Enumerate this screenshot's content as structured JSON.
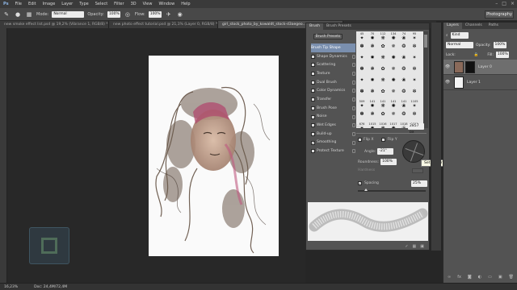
{
  "menu": {
    "items": [
      "File",
      "Edit",
      "Image",
      "Layer",
      "Type",
      "Select",
      "Filter",
      "3D",
      "View",
      "Window",
      "Help"
    ],
    "window_controls": [
      "–",
      "□",
      "×"
    ]
  },
  "options_bar": {
    "mode_label": "Mode:",
    "mode_value": "Normal",
    "opacity_label": "Opacity:",
    "opacity_value": "100%",
    "flow_label": "Flow:",
    "flow_value": "100%",
    "workspace": "Photography"
  },
  "tabs": [
    {
      "label": "new smoke effect list.psd @ 19,2% (Vibrance 1, RGB/8) *"
    },
    {
      "label": "new photo effect tutorial.psd @ 21,1% (Layer 0, RGB/8) *"
    },
    {
      "label": "girl_stock_photo_by_kowaldt_stock-d3aegeo..."
    }
  ],
  "status": {
    "zoom": "16,23%",
    "doc": "Doc: 24,4M/72,4M"
  },
  "brush_panel": {
    "tabs": [
      "Brush",
      "Brush Presets"
    ],
    "presets_button": "Brush Presets",
    "items": [
      {
        "label": "Brush Tip Shape",
        "checkbox": false,
        "selected": true
      },
      {
        "label": "Shape Dynamics",
        "checkbox": true,
        "checked": false
      },
      {
        "label": "Scattering",
        "checkbox": true,
        "checked": false
      },
      {
        "label": "Texture",
        "checkbox": true,
        "checked": false
      },
      {
        "label": "Dual Brush",
        "checkbox": true,
        "checked": false
      },
      {
        "label": "Color Dynamics",
        "checkbox": true,
        "checked": false
      },
      {
        "label": "Transfer",
        "checkbox": true,
        "checked": false
      },
      {
        "label": "Brush Pose",
        "checkbox": true,
        "checked": false
      },
      {
        "label": "Noise",
        "checkbox": true,
        "checked": false
      },
      {
        "label": "Wet Edges",
        "checkbox": true,
        "checked": false
      },
      {
        "label": "Build-up",
        "checkbox": true,
        "checked": false
      },
      {
        "label": "Smoothing",
        "checkbox": true,
        "checked": true
      },
      {
        "label": "Protect Texture",
        "checkbox": true,
        "checked": false
      }
    ],
    "grid_numbers": [
      "45",
      "70",
      "112",
      "134",
      "74",
      "95",
      "",
      "",
      "",
      "",
      "",
      "",
      "",
      "",
      "",
      "",
      "",
      "",
      "",
      "",
      "",
      "",
      "",
      "",
      "",
      "",
      "",
      "",
      "",
      "",
      "",
      "",
      "",
      "",
      "",
      "",
      "509",
      "141",
      "141",
      "141",
      "141",
      "1105",
      "",
      "",
      "",
      "",
      "",
      "",
      "676",
      "1015",
      "1016",
      "1017",
      "1018",
      "1019",
      "",
      "",
      "",
      "",
      "",
      "",
      "1020",
      "1021",
      "1024",
      "",
      "",
      ""
    ],
    "size_label": "Size",
    "size_value": "2857 px",
    "flip_x": "Flip X",
    "flip_y": "Flip Y",
    "angle_label": "Angle:",
    "angle_value": "-21°",
    "roundness_label": "Roundness:",
    "roundness_value": "100%",
    "hardness_label": "Hardness",
    "spacing_label": "Spacing",
    "spacing_value": "25%",
    "spacing_checked": true,
    "tooltip": "Set the brush angle and roundness"
  },
  "layers_panel": {
    "tabs": [
      "Layers",
      "Channels",
      "Paths"
    ],
    "kind_label": "Kind",
    "blend_mode": "Normal",
    "opacity_label": "Opacity:",
    "opacity_value": "100%",
    "lock_label": "Lock:",
    "fill_label": "Fill:",
    "fill_value": "100%",
    "layers": [
      {
        "name": "Layer 0",
        "selected": true
      },
      {
        "name": "Layer 1",
        "selected": false
      }
    ]
  }
}
